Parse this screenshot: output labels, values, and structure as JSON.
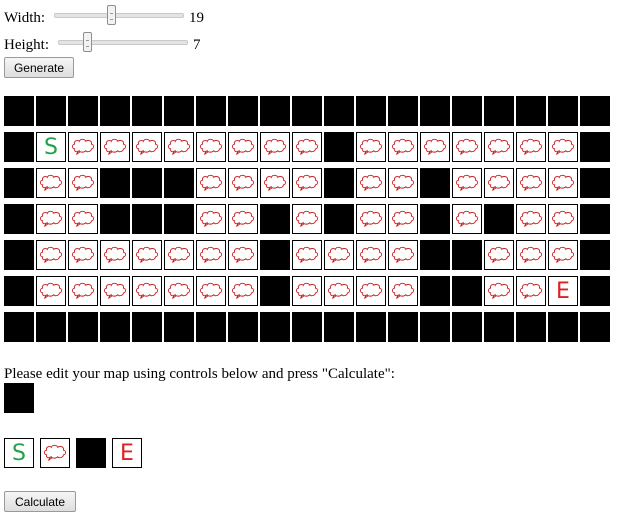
{
  "controls": {
    "width_label": "Width:",
    "width_value": "19",
    "height_label": "Height:",
    "height_value": "7",
    "width_slider_fraction": 0.44,
    "height_slider_fraction": 0.2,
    "generate_label": "Generate"
  },
  "map": {
    "rows": [
      "WWWWWWWWWWWWWWWWWWW",
      "WSOOOOOOOOWOOOOOOOW",
      "WOOWWWOOOOWOOWOOOOW",
      "WOOWWWOOWOWOOWOWOOW",
      "WOOOOOOOWOOOOWWOOOW",
      "WOOOOOOOWOOOOWWOOEW",
      "WWWWWWWWWWWWWWWWWWW"
    ],
    "legend": {
      "W": "wall",
      "O": "open-cloud",
      "S": "start",
      "E": "end"
    },
    "colors": {
      "wall": "#000000",
      "cloud": "#cc2222",
      "start": "#1fa34a",
      "end": "#e02020"
    }
  },
  "editor": {
    "instruction": "Please edit your map using controls below and press \"Calculate\":",
    "selected_tool": "wall",
    "palette": [
      "start",
      "open-cloud",
      "wall",
      "end"
    ],
    "start_glyph": "S",
    "end_glyph": "E",
    "calculate_label": "Calculate"
  }
}
